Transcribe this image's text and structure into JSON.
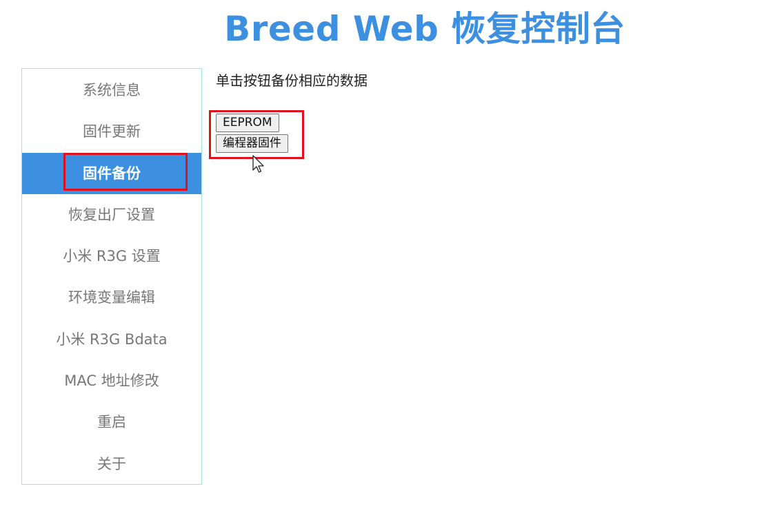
{
  "header": {
    "title": "Breed Web 恢复控制台"
  },
  "sidebar": {
    "items": [
      {
        "label": "系统信息",
        "active": false
      },
      {
        "label": "固件更新",
        "active": false
      },
      {
        "label": "固件备份",
        "active": true
      },
      {
        "label": "恢复出厂设置",
        "active": false
      },
      {
        "label": "小米 R3G 设置",
        "active": false
      },
      {
        "label": "环境变量编辑",
        "active": false
      },
      {
        "label": "小米 R3G Bdata",
        "active": false
      },
      {
        "label": "MAC 地址修改",
        "active": false
      },
      {
        "label": "重启",
        "active": false
      },
      {
        "label": "关于",
        "active": false
      }
    ]
  },
  "main": {
    "description": "单击按钮备份相应的数据",
    "buttons": {
      "eeprom": "EEPROM",
      "programmer_firmware": "编程器固件"
    }
  },
  "colors": {
    "accent": "#3d8fe0",
    "highlight": "#e0101c",
    "sidebar_border": "#9fe3e0"
  },
  "icons": {
    "cursor": "mouse-pointer-icon"
  }
}
